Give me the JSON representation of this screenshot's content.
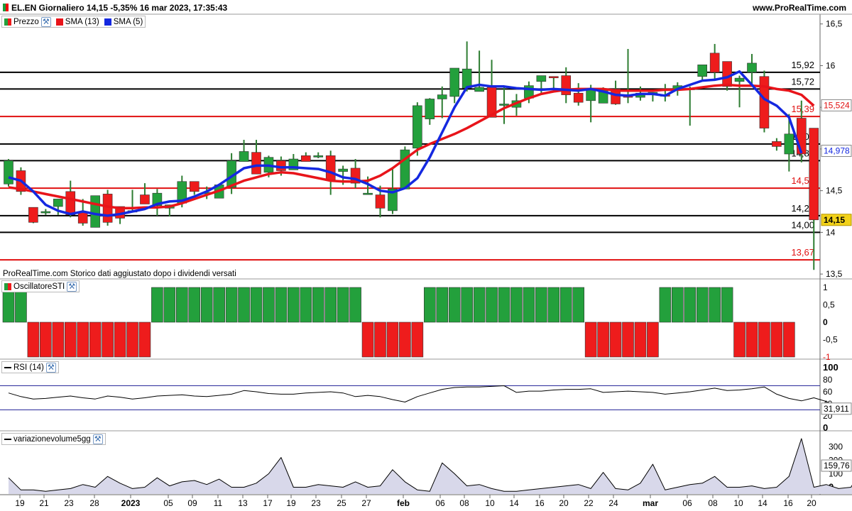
{
  "header": {
    "title": "EL.EN Giornaliero 14,15 -5,35% 16 mar 2023, 17:35:43",
    "site": "www.ProRealTime.com",
    "footnote": "ProRealTime.com  Storico dati aggiustato dopo i dividendi versati"
  },
  "legend": {
    "price": "Prezzo",
    "sma13": "SMA (13)",
    "sma5": "SMA (5)",
    "osc": "OscillatoreSTI",
    "rsi": "RSI (14)",
    "vol": "variazionevolume5gg"
  },
  "colors": {
    "up": "#23a03c",
    "down": "#ee1c1c",
    "sma13": "#e8141a",
    "sma5": "#1428e0",
    "black_level": "#000000",
    "red_level": "#e01010",
    "rsi_line": "#000000",
    "rsi_band": "#2a2a9a",
    "vol_fill": "#d8d8ea",
    "last_price_bg": "#f2d21a"
  },
  "chart_data": [
    {
      "type": "candlestick",
      "title": "EL.EN Giornaliero",
      "x_tick_labels": [
        "19",
        "21",
        "23",
        "28",
        "2023",
        "05",
        "09",
        "11",
        "13",
        "17",
        "19",
        "23",
        "25",
        "27",
        "feb",
        "06",
        "08",
        "10",
        "14",
        "16",
        "20",
        "22",
        "24",
        "mar",
        "06",
        "08",
        "10",
        "14",
        "16",
        "20"
      ],
      "ylim": [
        13.45,
        16.6
      ],
      "y_ticks": [
        "13,5",
        "14",
        "14,5",
        "15",
        "15,5",
        "16",
        "16,5"
      ],
      "candles": [
        {
          "o": 14.58,
          "h": 14.88,
          "l": 14.55,
          "c": 14.86
        },
        {
          "o": 14.74,
          "h": 14.78,
          "l": 14.45,
          "c": 14.49
        },
        {
          "o": 14.3,
          "h": 14.3,
          "l": 14.11,
          "c": 14.12
        },
        {
          "o": 14.25,
          "h": 14.28,
          "l": 14.21,
          "c": 14.25
        },
        {
          "o": 14.31,
          "h": 14.37,
          "l": 14.21,
          "c": 14.4
        },
        {
          "o": 14.49,
          "h": 14.62,
          "l": 14.18,
          "c": 14.21
        },
        {
          "o": 14.25,
          "h": 14.4,
          "l": 14.08,
          "c": 14.11
        },
        {
          "o": 14.06,
          "h": 14.44,
          "l": 14.06,
          "c": 14.44
        },
        {
          "o": 14.46,
          "h": 14.51,
          "l": 14.08,
          "c": 14.12
        },
        {
          "o": 14.31,
          "h": 14.31,
          "l": 14.1,
          "c": 14.17
        },
        {
          "o": 14.26,
          "h": 14.51,
          "l": 14.25,
          "c": 14.26
        },
        {
          "o": 14.45,
          "h": 14.59,
          "l": 14.38,
          "c": 14.34
        },
        {
          "o": 14.32,
          "h": 14.52,
          "l": 14.2,
          "c": 14.47
        },
        {
          "o": 14.29,
          "h": 14.32,
          "l": 14.19,
          "c": 14.33
        },
        {
          "o": 14.35,
          "h": 14.68,
          "l": 14.3,
          "c": 14.61
        },
        {
          "o": 14.61,
          "h": 14.61,
          "l": 14.45,
          "c": 14.49
        },
        {
          "o": 14.48,
          "h": 14.55,
          "l": 14.4,
          "c": 14.48
        },
        {
          "o": 14.41,
          "h": 14.55,
          "l": 14.42,
          "c": 14.57
        },
        {
          "o": 14.54,
          "h": 14.95,
          "l": 14.46,
          "c": 14.86
        },
        {
          "o": 14.85,
          "h": 15.11,
          "l": 14.91,
          "c": 14.97
        },
        {
          "o": 14.96,
          "h": 15.11,
          "l": 14.7,
          "c": 14.7
        },
        {
          "o": 14.72,
          "h": 14.92,
          "l": 14.66,
          "c": 14.9
        },
        {
          "o": 14.86,
          "h": 14.91,
          "l": 14.68,
          "c": 14.74
        },
        {
          "o": 14.75,
          "h": 14.94,
          "l": 14.78,
          "c": 14.88
        },
        {
          "o": 14.92,
          "h": 14.96,
          "l": 14.87,
          "c": 14.85
        },
        {
          "o": 14.91,
          "h": 14.96,
          "l": 14.89,
          "c": 14.92
        },
        {
          "o": 14.92,
          "h": 14.98,
          "l": 14.45,
          "c": 14.63
        },
        {
          "o": 14.73,
          "h": 14.8,
          "l": 14.57,
          "c": 14.76
        },
        {
          "o": 14.77,
          "h": 14.88,
          "l": 14.53,
          "c": 14.59
        },
        {
          "o": 14.47,
          "h": 14.67,
          "l": 14.5,
          "c": 14.47
        },
        {
          "o": 14.45,
          "h": 14.56,
          "l": 14.18,
          "c": 14.29
        },
        {
          "o": 14.26,
          "h": 14.76,
          "l": 14.22,
          "c": 14.52
        },
        {
          "o": 14.52,
          "h": 15.03,
          "l": 14.55,
          "c": 14.99
        },
        {
          "o": 15.01,
          "h": 15.56,
          "l": 14.92,
          "c": 15.52
        },
        {
          "o": 15.36,
          "h": 15.61,
          "l": 15.29,
          "c": 15.6
        },
        {
          "o": 15.6,
          "h": 15.75,
          "l": 15.37,
          "c": 15.65
        },
        {
          "o": 15.63,
          "h": 15.89,
          "l": 15.55,
          "c": 15.97
        },
        {
          "o": 15.73,
          "h": 16.29,
          "l": 15.69,
          "c": 15.96
        },
        {
          "o": 15.69,
          "h": 16.18,
          "l": 15.7,
          "c": 15.74
        },
        {
          "o": 15.74,
          "h": 16.07,
          "l": 15.38,
          "c": 15.38
        },
        {
          "o": 15.54,
          "h": 15.76,
          "l": 15.3,
          "c": 15.54
        },
        {
          "o": 15.5,
          "h": 15.66,
          "l": 15.4,
          "c": 15.58
        },
        {
          "o": 15.61,
          "h": 15.81,
          "l": 15.55,
          "c": 15.76
        },
        {
          "o": 15.81,
          "h": 15.86,
          "l": 15.65,
          "c": 15.88
        },
        {
          "o": 15.87,
          "h": 15.87,
          "l": 15.7,
          "c": 15.86
        },
        {
          "o": 15.88,
          "h": 15.98,
          "l": 15.55,
          "c": 15.65
        },
        {
          "o": 15.67,
          "h": 15.79,
          "l": 15.52,
          "c": 15.56
        },
        {
          "o": 15.58,
          "h": 15.77,
          "l": 15.32,
          "c": 15.71
        },
        {
          "o": 15.55,
          "h": 15.74,
          "l": 15.56,
          "c": 15.71
        },
        {
          "o": 15.72,
          "h": 15.82,
          "l": 15.53,
          "c": 15.54
        },
        {
          "o": 15.64,
          "h": 16.2,
          "l": 15.55,
          "c": 15.62
        },
        {
          "o": 15.62,
          "h": 15.75,
          "l": 15.58,
          "c": 15.67
        },
        {
          "o": 15.65,
          "h": 15.66,
          "l": 15.57,
          "c": 15.68
        },
        {
          "o": 15.65,
          "h": 15.78,
          "l": 15.57,
          "c": 15.64
        },
        {
          "o": 15.72,
          "h": 15.8,
          "l": 15.64,
          "c": 15.76
        },
        {
          "o": 15.71,
          "h": 15.75,
          "l": 15.28,
          "c": 15.73
        },
        {
          "o": 15.87,
          "h": 15.97,
          "l": 15.83,
          "c": 16.01
        },
        {
          "o": 16.15,
          "h": 16.26,
          "l": 15.84,
          "c": 15.92
        },
        {
          "o": 16.05,
          "h": 16.05,
          "l": 15.7,
          "c": 15.75
        },
        {
          "o": 15.81,
          "h": 15.88,
          "l": 15.5,
          "c": 15.85
        },
        {
          "o": 15.92,
          "h": 16.14,
          "l": 15.78,
          "c": 16.03
        },
        {
          "o": 15.87,
          "h": 15.94,
          "l": 15.2,
          "c": 15.25
        },
        {
          "o": 15.09,
          "h": 15.13,
          "l": 14.98,
          "c": 15.03
        },
        {
          "o": 14.94,
          "h": 15.42,
          "l": 14.73,
          "c": 15.18
        },
        {
          "o": 15.37,
          "h": 15.58,
          "l": 14.84,
          "c": 14.94
        },
        {
          "o": 15.25,
          "h": 15.2,
          "l": 13.55,
          "c": 14.15
        }
      ],
      "sma13": [
        14.54,
        14.52,
        14.49,
        14.46,
        14.43,
        14.4,
        14.37,
        14.34,
        14.31,
        14.29,
        14.29,
        14.3,
        14.3,
        14.31,
        14.35,
        14.4,
        14.45,
        14.5,
        14.56,
        14.62,
        14.66,
        14.7,
        14.72,
        14.71,
        14.68,
        14.65,
        14.62,
        14.61,
        14.61,
        14.62,
        14.68,
        14.77,
        14.88,
        14.99,
        15.06,
        15.12,
        15.18,
        15.25,
        15.33,
        15.41,
        15.49,
        15.55,
        15.61,
        15.66,
        15.69,
        15.71,
        15.72,
        15.72,
        15.72,
        15.7,
        15.7,
        15.7,
        15.7,
        15.71,
        15.71,
        15.72,
        15.74,
        15.76,
        15.77,
        15.76,
        15.76,
        15.75,
        15.72,
        15.7,
        15.65,
        15.52
      ],
      "sma5": [
        14.66,
        14.62,
        14.49,
        14.33,
        14.26,
        14.22,
        14.25,
        14.22,
        14.2,
        14.22,
        14.25,
        14.28,
        14.34,
        14.37,
        14.38,
        14.43,
        14.49,
        14.57,
        14.67,
        14.77,
        14.8,
        14.8,
        14.78,
        14.78,
        14.77,
        14.76,
        14.72,
        14.66,
        14.64,
        14.58,
        14.5,
        14.48,
        14.53,
        14.65,
        14.9,
        15.2,
        15.5,
        15.74,
        15.77,
        15.75,
        15.75,
        15.73,
        15.72,
        15.71,
        15.72,
        15.71,
        15.7,
        15.72,
        15.69,
        15.65,
        15.64,
        15.66,
        15.66,
        15.64,
        15.72,
        15.77,
        15.82,
        15.83,
        15.86,
        15.93,
        15.77,
        15.6,
        15.52,
        15.38,
        14.95
      ],
      "levels": [
        {
          "label": "15,92",
          "value": 15.92,
          "color": "black"
        },
        {
          "label": "15,72",
          "value": 15.72,
          "color": "black"
        },
        {
          "label": "15,39",
          "value": 15.39,
          "color": "red"
        },
        {
          "label": "15,06",
          "value": 15.06,
          "color": "black"
        },
        {
          "label": "14,86",
          "value": 14.86,
          "color": "black"
        },
        {
          "label": "14,53",
          "value": 14.53,
          "color": "red"
        },
        {
          "label": "14,20",
          "value": 14.2,
          "color": "black"
        },
        {
          "label": "14,00",
          "value": 14.0,
          "color": "black"
        },
        {
          "label": "13,67",
          "value": 13.67,
          "color": "red"
        }
      ],
      "right_markers": [
        {
          "label": "15,524",
          "value": 15.524,
          "color": "red"
        },
        {
          "label": "14,978",
          "value": 14.978,
          "color": "blue"
        },
        {
          "label": "14,15",
          "value": 14.15,
          "color": "last"
        }
      ]
    },
    {
      "type": "bar",
      "title": "OscillatoreSTI",
      "ylim": [
        -1,
        1
      ],
      "y_ticks": [
        "1",
        "0,5",
        "0",
        "-0,5",
        "-1"
      ],
      "values": [
        1,
        1,
        -1,
        -1,
        -1,
        -1,
        -1,
        -1,
        -1,
        -1,
        -1,
        -1,
        1,
        1,
        1,
        1,
        1,
        1,
        1,
        1,
        1,
        1,
        1,
        1,
        1,
        1,
        1,
        1,
        1,
        -1,
        -1,
        -1,
        -1,
        -1,
        1,
        1,
        1,
        1,
        1,
        1,
        1,
        1,
        1,
        1,
        1,
        1,
        1,
        -1,
        -1,
        -1,
        -1,
        -1,
        -1,
        1,
        1,
        1,
        1,
        1,
        1,
        -1,
        -1,
        -1,
        -1,
        -1
      ]
    },
    {
      "type": "line",
      "title": "RSI (14)",
      "ylim": [
        0,
        100
      ],
      "y_ticks": [
        "100",
        "80",
        "60",
        "40",
        "20",
        "0"
      ],
      "bands": [
        70,
        30
      ],
      "last_label": "31,911",
      "values": [
        58,
        52,
        48,
        49,
        51,
        53,
        50,
        48,
        53,
        51,
        48,
        50,
        53,
        54,
        55,
        53,
        52,
        54,
        56,
        62,
        60,
        57,
        56,
        56,
        58,
        59,
        60,
        58,
        52,
        54,
        52,
        47,
        43,
        52,
        58,
        64,
        67,
        68,
        68,
        69,
        70,
        59,
        61,
        61,
        63,
        64,
        64,
        65,
        59,
        60,
        61,
        60,
        59,
        56,
        58,
        60,
        63,
        66,
        62,
        63,
        65,
        68,
        56,
        49,
        45,
        50,
        44,
        32
      ]
    },
    {
      "type": "area",
      "title": "variazionevolume5gg",
      "ylim": [
        -50,
        360
      ],
      "y_ticks": [
        "300",
        "200",
        "100",
        "0"
      ],
      "last_label": "159,76",
      "values": [
        70,
        -20,
        -20,
        -30,
        -20,
        -10,
        20,
        0,
        80,
        30,
        -10,
        0,
        70,
        10,
        40,
        50,
        20,
        60,
        0,
        0,
        30,
        100,
        220,
        0,
        0,
        20,
        10,
        0,
        40,
        0,
        10,
        130,
        40,
        -20,
        -30,
        180,
        100,
        10,
        20,
        -10,
        -30,
        -30,
        -20,
        -10,
        0,
        10,
        20,
        -10,
        110,
        -10,
        -20,
        30,
        170,
        -20,
        0,
        20,
        30,
        80,
        0,
        0,
        10,
        -10,
        0,
        80,
        360,
        0,
        20,
        -10,
        0,
        160
      ]
    }
  ]
}
